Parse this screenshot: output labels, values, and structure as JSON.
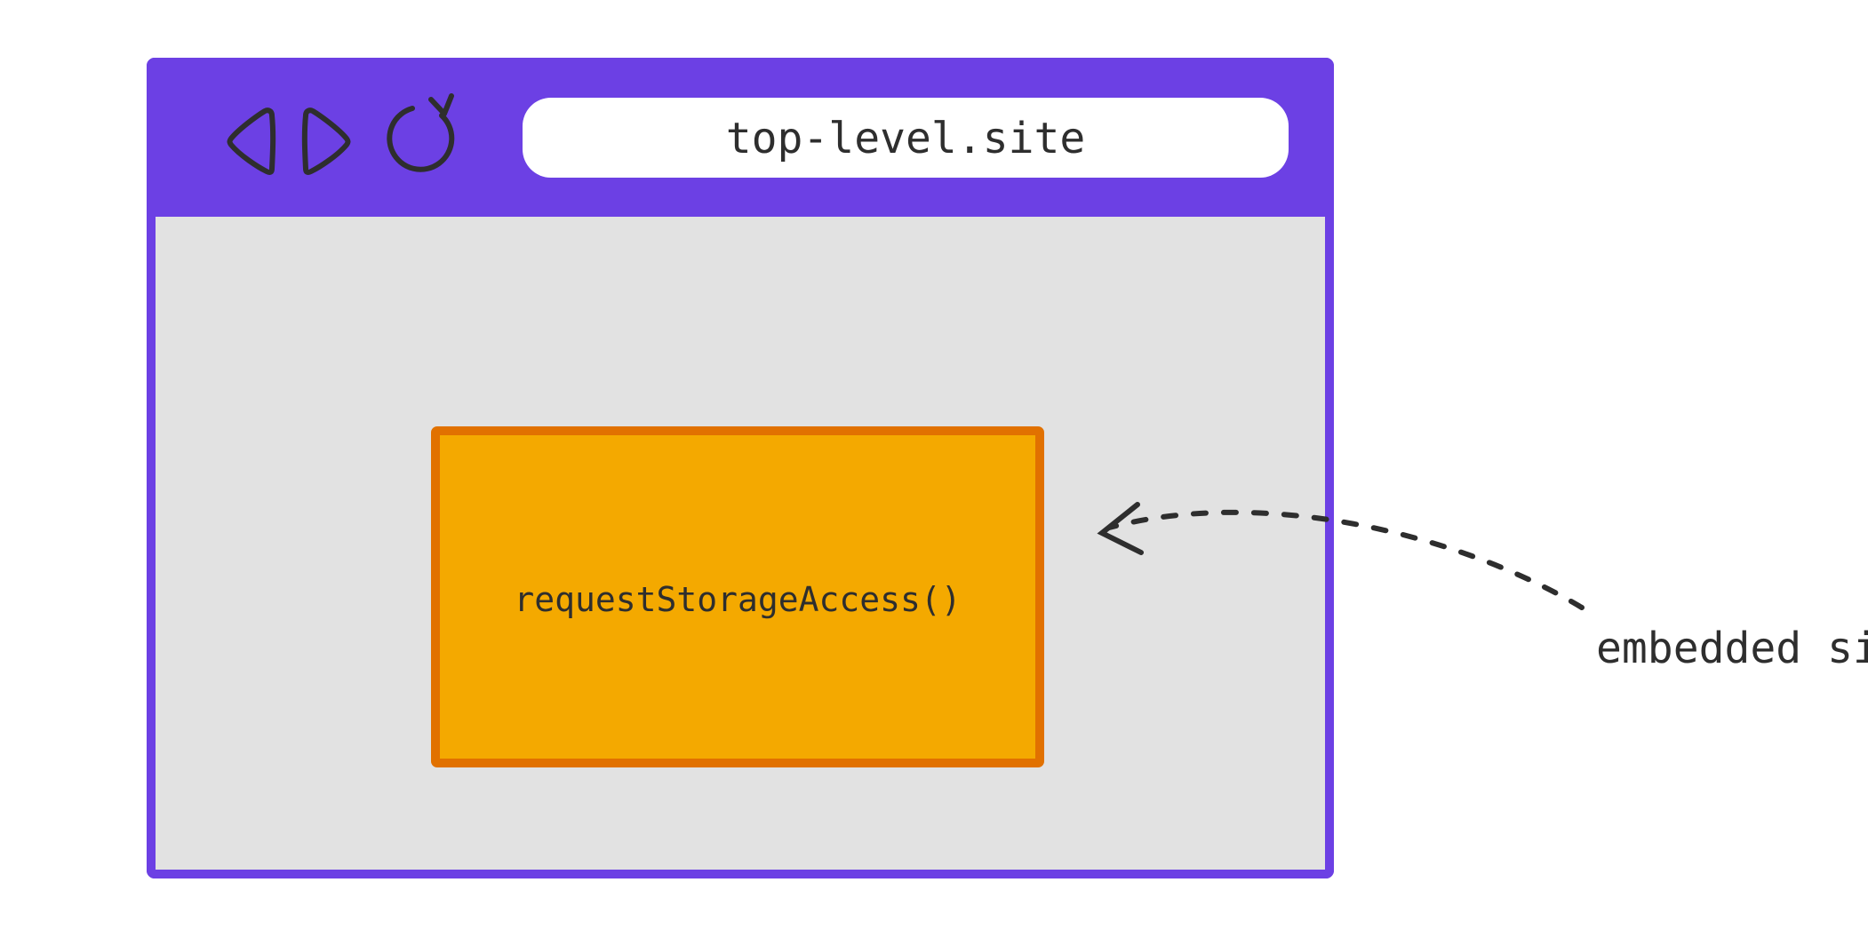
{
  "colors": {
    "accent_purple": "#6c40e4",
    "panel_gray": "#e2e2e2",
    "ink": "#2e2e2e",
    "embed_fill": "#f4a900",
    "embed_stroke": "#e17100",
    "white": "#ffffff"
  },
  "browser": {
    "address_bar": {
      "url": "top-level.site"
    },
    "nav": {
      "back_label": "back",
      "forward_label": "forward",
      "reload_label": "reload"
    }
  },
  "embedded": {
    "code": "requestStorageAccess()"
  },
  "annotation": {
    "label": "embedded site"
  }
}
